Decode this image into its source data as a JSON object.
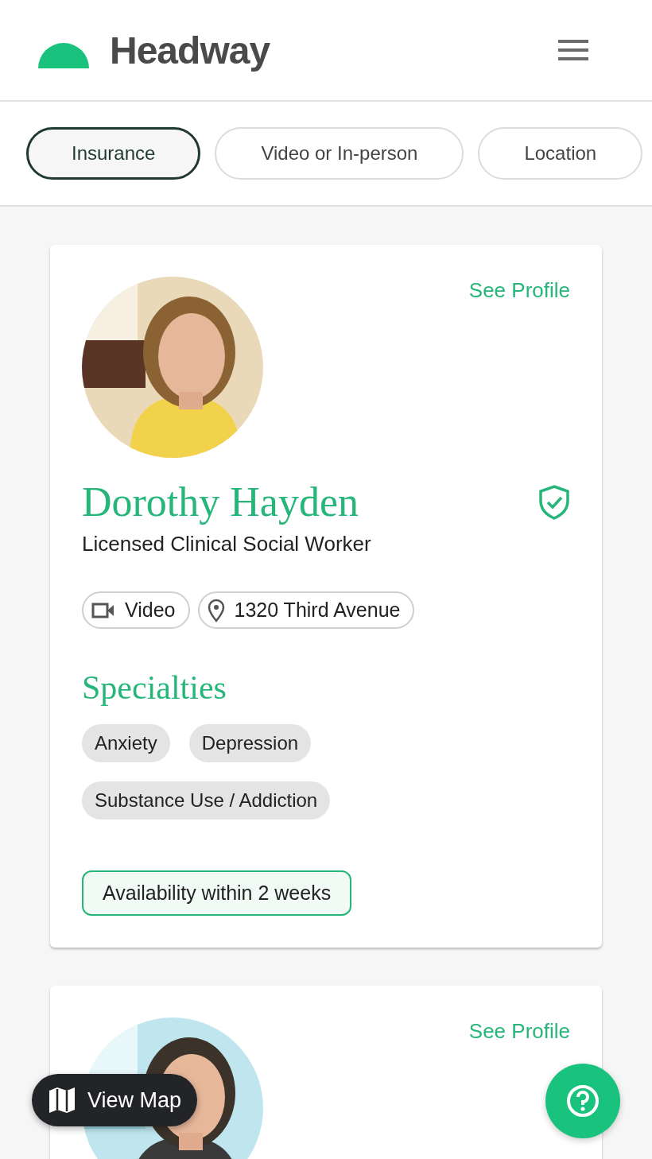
{
  "header": {
    "brand": "Headway"
  },
  "filters": [
    {
      "label": "Insurance",
      "selected": true
    },
    {
      "label": "Video or In-person",
      "selected": false
    },
    {
      "label": "Location",
      "selected": false
    }
  ],
  "providers": [
    {
      "see_profile": "See Profile",
      "picture": {
        "kind": "picture"
      },
      "name": "Dorothy Hayden",
      "verified": true,
      "credential": "Licensed Clinical Social Worker",
      "modes": [
        {
          "kind": "video",
          "label": "Video"
        },
        {
          "kind": "location",
          "label": "1320 Third Avenue"
        }
      ],
      "specialties_title": "Specialties",
      "specialties": [
        "Anxiety",
        "Depression",
        "Substance Use / Addiction"
      ],
      "availability": "Availability within 2 weeks"
    },
    {
      "see_profile": "See Profile",
      "picture": {
        "kind": "picture"
      }
    }
  ],
  "view_map": {
    "label": "View Map"
  }
}
